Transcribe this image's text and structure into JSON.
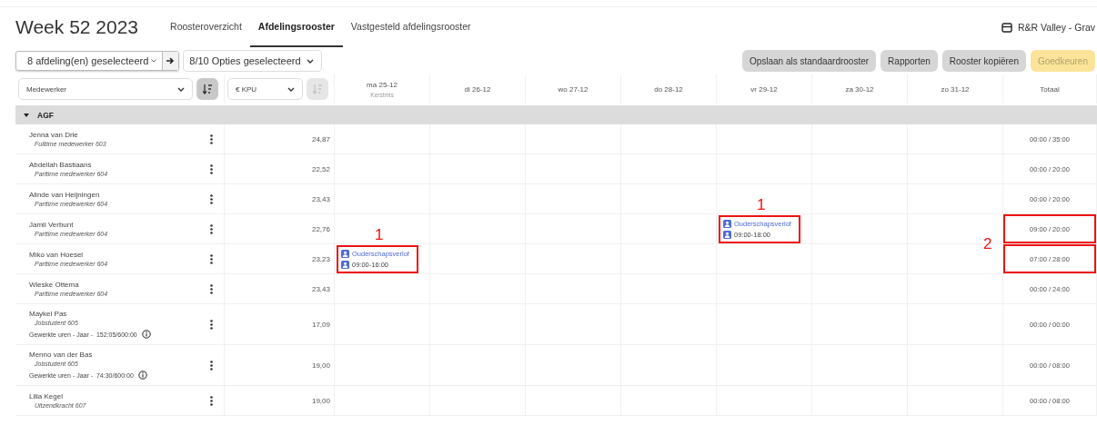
{
  "header": {
    "title": "Week 52 2023",
    "tabs": [
      {
        "label": "Roosteroverzicht",
        "selected": false
      },
      {
        "label": "Afdelingsrooster",
        "selected": true
      },
      {
        "label": "Vastgesteld afdelingsrooster",
        "selected": false
      }
    ],
    "location": "R&R Valley - Grav"
  },
  "filters": {
    "departments": "8 afdeling(en) geselecteerd",
    "options": "8/10 Opties geselecteerd"
  },
  "actions": [
    {
      "label": "Opslaan als standaardrooster",
      "kind": "secondary"
    },
    {
      "label": "Rapporten",
      "kind": "secondary"
    },
    {
      "label": "Rooster kopiëren",
      "kind": "secondary"
    },
    {
      "label": "Goedkeuren",
      "kind": "approve"
    }
  ],
  "table": {
    "sort_fields": [
      {
        "label": "Medewerker",
        "disabled": false
      },
      {
        "label": "€ KPU",
        "disabled": true
      }
    ],
    "days": [
      {
        "label": "ma 25-12",
        "note": "Kerstmis"
      },
      {
        "label": "di 26-12"
      },
      {
        "label": "wo 27-12"
      },
      {
        "label": "do 28-12"
      },
      {
        "label": "vr 29-12"
      },
      {
        "label": "za 30-12"
      },
      {
        "label": "zo 31-12"
      }
    ],
    "total_heading": "Totaal",
    "group": {
      "name": "AGF",
      "expanded": true
    },
    "rows": [
      {
        "name": "Jenna van Drie",
        "role": "Fulltime medewerker 603",
        "kpu": "24,87",
        "cells": [
          {
            "kind": "empty"
          },
          {
            "kind": "empty"
          },
          {
            "kind": "empty"
          },
          {
            "kind": "empty"
          },
          {
            "kind": "empty"
          },
          {
            "kind": "empty"
          },
          {
            "kind": "empty"
          }
        ],
        "total": "00:00 / 35:00",
        "highlighted": false
      },
      {
        "name": "Abdellah Bastiaans",
        "role": "Parttime medewerker 604",
        "kpu": "22,52",
        "cells": [
          {
            "kind": "empty"
          },
          {
            "kind": "empty"
          },
          {
            "kind": "empty"
          },
          {
            "kind": "empty"
          },
          {
            "kind": "empty"
          },
          {
            "kind": "empty"
          },
          {
            "kind": "empty"
          }
        ],
        "total": "00:00 / 20:00",
        "highlighted": false
      },
      {
        "name": "Alinde van Heijningen",
        "role": "Parttime medewerker 604",
        "kpu": "23,43",
        "cells": [
          {
            "kind": "empty"
          },
          {
            "kind": "empty"
          },
          {
            "kind": "empty"
          },
          {
            "kind": "empty"
          },
          {
            "kind": "empty"
          },
          {
            "kind": "empty"
          },
          {
            "kind": "empty"
          }
        ],
        "total": "00:00 / 20:00",
        "highlighted": false
      },
      {
        "name": "Jamil Verbunt",
        "role": "Parttime medewerker 604",
        "kpu": "22,76",
        "cells": [
          {
            "kind": "empty"
          },
          {
            "kind": "empty"
          },
          {
            "kind": "empty"
          },
          {
            "kind": "empty"
          },
          {
            "kind": "leave",
            "type": "Ouderschapsverlof",
            "time": "09:00-18:00",
            "highlighted": true,
            "marker": "1"
          },
          {
            "kind": "empty"
          },
          {
            "kind": "empty"
          }
        ],
        "total": "09:00 / 20:00",
        "highlighted": true,
        "marker": "2"
      },
      {
        "name": "Miko van Hoesel",
        "role": "Parttime medewerker 604",
        "kpu": "23,23",
        "cells": [
          {
            "kind": "leave",
            "type": "Ouderschapsverlof",
            "time": "09:00-16:00",
            "highlighted": true,
            "marker": "1"
          },
          {
            "kind": "empty"
          },
          {
            "kind": "empty"
          },
          {
            "kind": "empty"
          },
          {
            "kind": "empty"
          },
          {
            "kind": "empty"
          },
          {
            "kind": "empty"
          }
        ],
        "total": "07:00 / 28:00",
        "highlighted": true
      },
      {
        "name": "Wieske Ottema",
        "role": "Parttime medewerker 604",
        "kpu": "23,43",
        "cells": [
          {
            "kind": "empty"
          },
          {
            "kind": "empty"
          },
          {
            "kind": "empty"
          },
          {
            "kind": "empty"
          },
          {
            "kind": "empty"
          },
          {
            "kind": "empty"
          },
          {
            "kind": "empty"
          }
        ],
        "total": "00:00 / 24:00",
        "highlighted": false
      },
      {
        "name": "Maykel Pas",
        "role": "Jobstudent 605",
        "hours": "Gewerkte uren - Jaar -  152:05/600:00",
        "kpu": "17,09",
        "cells": [
          {
            "kind": "empty"
          },
          {
            "kind": "empty"
          },
          {
            "kind": "empty"
          },
          {
            "kind": "empty"
          },
          {
            "kind": "empty"
          },
          {
            "kind": "empty"
          },
          {
            "kind": "empty"
          }
        ],
        "total": "00:00 / 00:00",
        "highlighted": false
      },
      {
        "name": "Menno van der Bas",
        "role": "Jobstudent 605",
        "hours": "Gewerkte uren - Jaar -  74:30/600:00",
        "kpu": "19,00",
        "cells": [
          {
            "kind": "empty"
          },
          {
            "kind": "empty"
          },
          {
            "kind": "empty"
          },
          {
            "kind": "empty"
          },
          {
            "kind": "empty"
          },
          {
            "kind": "empty"
          },
          {
            "kind": "empty"
          }
        ],
        "total": "00:00 / 08:00",
        "highlighted": false
      },
      {
        "name": "Lilia Kegel",
        "role": "Uitzendkracht 607",
        "kpu": "19,00",
        "cells": [
          {
            "kind": "empty"
          },
          {
            "kind": "empty"
          },
          {
            "kind": "empty"
          },
          {
            "kind": "empty"
          },
          {
            "kind": "empty"
          },
          {
            "kind": "empty"
          },
          {
            "kind": "empty"
          }
        ],
        "total": "00:00 / 08:00",
        "highlighted": false
      }
    ]
  }
}
